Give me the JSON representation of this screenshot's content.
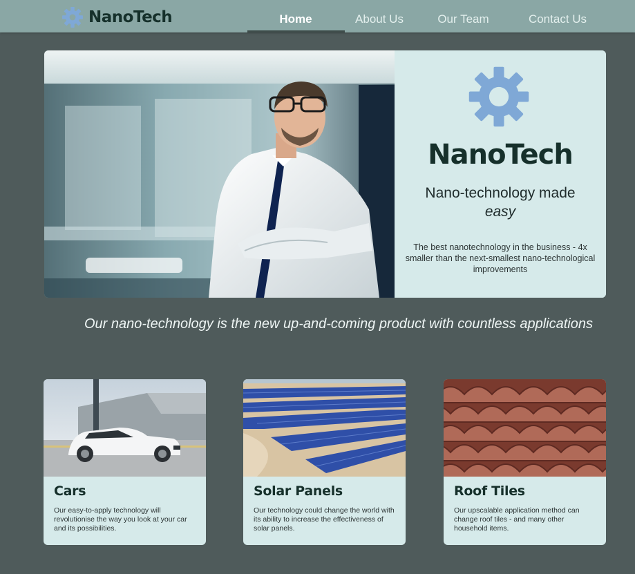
{
  "nav": {
    "brand": "NanoTech",
    "links": [
      {
        "label": "Home",
        "active": true
      },
      {
        "label": "About Us",
        "active": false
      },
      {
        "label": "Our Team",
        "active": false
      },
      {
        "label": "Contact Us",
        "active": false
      }
    ]
  },
  "hero": {
    "title": "NanoTech",
    "tagline_line1": "Nano-technology made",
    "tagline_line2": "easy",
    "description": "The best nanotechnology in the business - 4x smaller than the next-smallest nano-technological improvements"
  },
  "slogan": "Our nano-technology is the new up-and-coming product with countless applications",
  "cards": [
    {
      "title": "Cars",
      "text": "Our easy-to-apply technology will revolutionise the way you look at your car and its possibilities."
    },
    {
      "title": "Solar Panels",
      "text": "Our technology could change the world with its ability to increase the effectiveness of solar panels."
    },
    {
      "title": "Roof Tiles",
      "text": "Our upscalable application method can change roof tiles - and many other household items."
    }
  ],
  "colors": {
    "page_background": "#4f5b5b",
    "navbar": "#8aa7a5",
    "panel": "#d6eaea",
    "gear": "#7fa8d6",
    "heading": "#16302b"
  },
  "icons": {
    "brand": "gear-icon",
    "hero": "gear-icon"
  }
}
